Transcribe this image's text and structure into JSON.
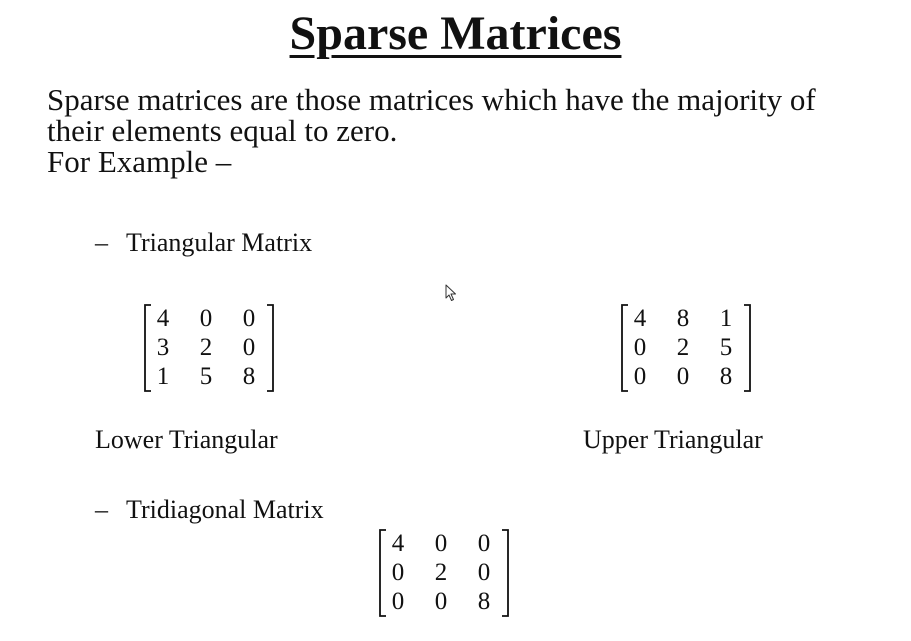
{
  "title": "Sparse Matrices",
  "intro": {
    "line1": "Sparse matrices are those matrices which have the majority of",
    "line2": "their elements equal to zero.",
    "line3": "For Example –"
  },
  "sections": {
    "triangular": {
      "dash": "–",
      "label": "Triangular Matrix",
      "lower": {
        "rows": [
          [
            "4",
            "0",
            "0"
          ],
          [
            "3",
            "2",
            "0"
          ],
          [
            "1",
            "5",
            "8"
          ]
        ],
        "caption": "Lower Triangular"
      },
      "upper": {
        "rows": [
          [
            "4",
            "8",
            "1"
          ],
          [
            "0",
            "2",
            "5"
          ],
          [
            "0",
            "0",
            "8"
          ]
        ],
        "caption": "Upper Triangular"
      }
    },
    "tridiagonal": {
      "dash": "–",
      "label": "Tridiagonal Matrix",
      "matrix": {
        "rows": [
          [
            "4",
            "0",
            "0"
          ],
          [
            "0",
            "2",
            "0"
          ],
          [
            "0",
            "0",
            "8"
          ]
        ]
      }
    }
  },
  "cursor_icon": "mouse-pointer-icon"
}
